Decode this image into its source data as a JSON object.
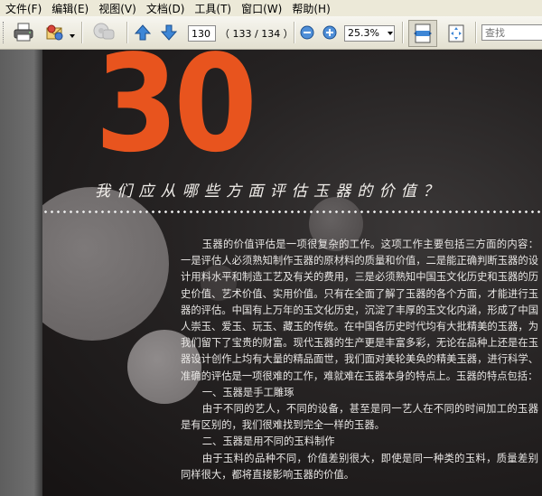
{
  "menu": {
    "items": [
      "文件(F)",
      "编辑(E)",
      "视图(V)",
      "文档(D)",
      "工具(T)",
      "窗口(W)",
      "帮助(H)"
    ]
  },
  "toolbar": {
    "page_input": "130",
    "page_count": "（ 133 / 134 ）",
    "zoom_value": "25.3%",
    "search_placeholder": "查找"
  },
  "page": {
    "number": "30",
    "heading": "我们应从哪些方面评估玉器的价值？",
    "paragraphs": [
      "玉器的价值评估是一项很复杂的工作。这项工作主要包括三方面的内容：一是评估人必须熟知制作玉器的原材料的质量和价值，二是能正确判断玉器的设计用料水平和制造工艺及有关的费用，三是必须熟知中国玉文化历史和玉器的历史价值、艺术价值、实用价值。只有在全面了解了玉器的各个方面，才能进行玉器的评估。中国有上万年的玉文化历史，沉淀了丰厚的玉文化内涵，形成了中国人崇玉、爱玉、玩玉、藏玉的传统。在中国各历史时代均有大批精美的玉器，为我们留下了宝贵的财富。现代玉器的生产更是丰富多彩，无论在品种上还是在玉器设计创作上均有大量的精品面世，我们面对美轮美奂的精美玉器，进行科学、准确的评估是一项很难的工作，难就难在玉器本身的特点上。玉器的特点包括：",
      "一、玉器是手工雕琢",
      "由于不同的艺人，不同的设备，甚至是同一艺人在不同的时间加工的玉器是有区别的，我们很难找到完全一样的玉器。",
      "二、玉器是用不同的玉料制作",
      "由于玉料的品种不同，价值差别很大，即使是同一种类的玉料，质量差别同样很大，都将直接影响玉器的价值。"
    ]
  },
  "colors": {
    "accent_orange": "#e8541e",
    "chrome": "#ece9d8",
    "page_dark": "#231f1f"
  },
  "icons": [
    "print-icon",
    "mail-attach-icon",
    "hand-tool-icon",
    "prev-page-icon",
    "next-page-icon",
    "zoom-out-icon",
    "zoom-in-icon",
    "fit-width-icon",
    "fit-page-icon"
  ]
}
